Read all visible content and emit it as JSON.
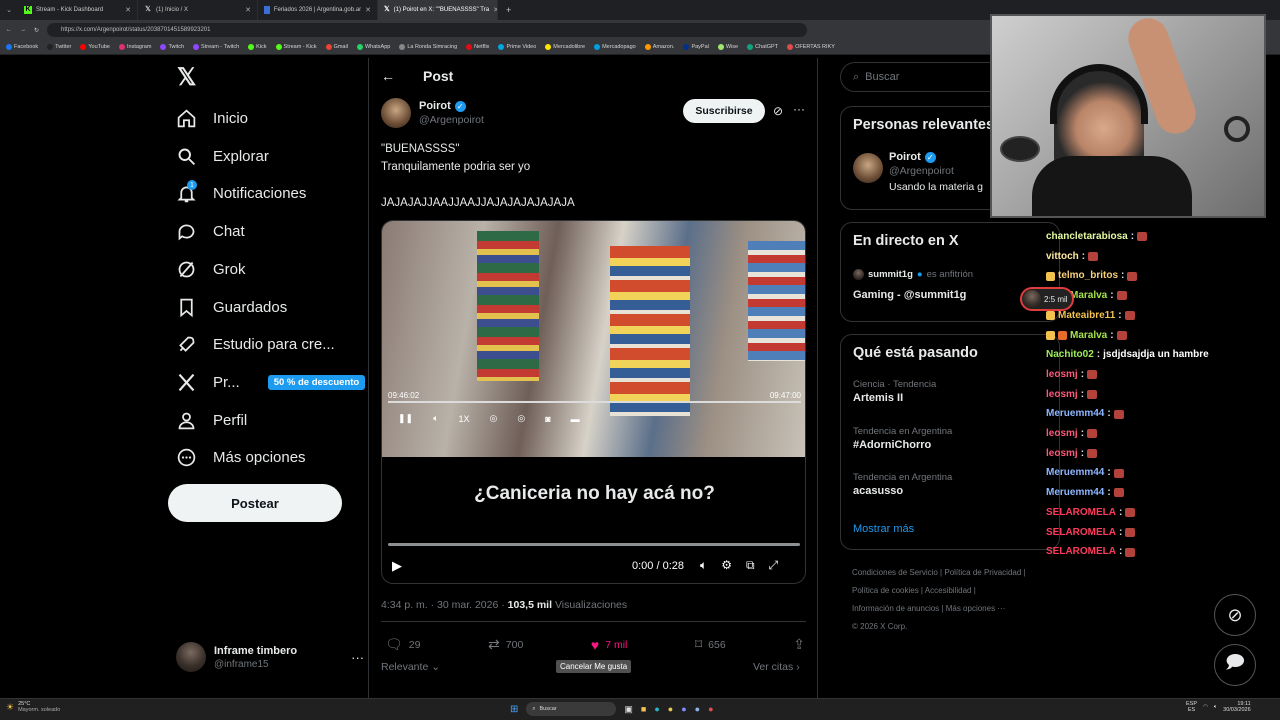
{
  "browser": {
    "tabs": [
      {
        "label": "Stream - Kick Dashboard",
        "icon": "kick-icon",
        "active": false
      },
      {
        "label": "(1) Inicio / X",
        "icon": "x-logo-icon",
        "active": false
      },
      {
        "label": "Feriados 2026 | Argentina.gob.ar",
        "icon": "gob-icon",
        "active": false
      },
      {
        "label": "(1) Poirot en X: \"\"BUENASSSS\" Tra",
        "icon": "x-logo-icon",
        "active": true
      }
    ],
    "new_tab": "+",
    "url": "https://x.com/Argenpoirot/status/2038701451589923201",
    "bookmarks": [
      "Facebook",
      "Twitter",
      "YouTube",
      "Instagram",
      "Twitch",
      "Stream - Twitch",
      "Kick",
      "Stream - Kick",
      "Gmail",
      "WhatsApp",
      "La Ronda Simracing",
      "Netflix",
      "Prime Video",
      "Mercadolibre",
      "Mercadopago",
      "Amazon.",
      "PayPal",
      "Wise",
      "ChatGPT",
      "OFERTAS RIKY"
    ]
  },
  "nav": {
    "items": [
      {
        "label": "Inicio",
        "icon": "home-icon"
      },
      {
        "label": "Explorar",
        "icon": "search-icon"
      },
      {
        "label": "Notificaciones",
        "icon": "bell-icon",
        "badge": "1"
      },
      {
        "label": "Chat",
        "icon": "chat-icon"
      },
      {
        "label": "Grok",
        "icon": "grok-icon"
      },
      {
        "label": "Guardados",
        "icon": "bookmark-icon"
      },
      {
        "label": "Estudio para cre...",
        "icon": "rocket-icon"
      },
      {
        "label": "Pr...",
        "icon": "x-logo-icon",
        "promo": "50 % de descuento"
      },
      {
        "label": "Perfil",
        "icon": "person-icon"
      },
      {
        "label": "Más opciones",
        "icon": "more-circle-icon"
      }
    ],
    "post_button": "Postear",
    "account": {
      "name": "Inframe timbero",
      "handle": "@inframe15"
    }
  },
  "post": {
    "header_title": "Post",
    "author": {
      "name": "Poirot",
      "handle": "@Argenpoirot"
    },
    "subscribe": "Suscribirse",
    "text_lines": [
      "\"BUENASSSS\"",
      "Tranquilamente podria ser yo",
      "JAJAJAJJAAJJAAJJAJAJAJAJAJAJA"
    ],
    "video": {
      "caption": "¿Caniceria no hay acá no?",
      "time": "0:00 / 0:28",
      "cctv_start": "09:46:02",
      "cctv_end": "09:47:00",
      "speed": "1X",
      "progress": 0
    },
    "meta": {
      "time": "4:34 p. m. · 30 mar. 2026 · ",
      "views": "103,5 mil",
      "views_label": " Visualizaciones"
    },
    "actions": {
      "replies": "29",
      "reposts": "700",
      "likes": "7 mil",
      "bookmarks": "656"
    },
    "tooltip": "Cancelar Me gusta",
    "sort_label": "Relevante",
    "quotes_link": "Ver citas"
  },
  "right": {
    "search_placeholder": "Buscar",
    "people": {
      "title": "Personas relevantes",
      "name": "Poirot",
      "handle": "@Argenpoirot",
      "bio": "Usando la materia g"
    },
    "live": {
      "title": "En directo en X",
      "host": "summit1g",
      "host_suffix": "es anfitrión",
      "show": "Gaming - @summit1g"
    },
    "trends": {
      "title": "Qué está pasando",
      "items": [
        {
          "context": "Ciencia · Tendencia",
          "name": "Artemis II"
        },
        {
          "context": "Tendencia en Argentina",
          "name": "#AdorniChorro"
        },
        {
          "context": "Tendencia en Argentina",
          "name": "acasusso"
        }
      ],
      "show_more": "Mostrar más"
    },
    "footer": [
      "Condiciones de Servicio",
      "Política de Privacidad",
      "Política de cookies",
      "Accesibilidad",
      "Información de anuncios",
      "Más opciones ···",
      "© 2026 X Corp."
    ]
  },
  "chat_messages": [
    {
      "user": "chancletarabiosa",
      "text": "",
      "color": "#e4f9a0",
      "badges": 0
    },
    {
      "user": "vittoch",
      "text": "",
      "color": "#ffe8a0",
      "badges": 0
    },
    {
      "user": "telmo_britos",
      "text": "",
      "color": "#f8d078",
      "badges": 1
    },
    {
      "user": "Maralva",
      "text": "",
      "color": "#a6e34f",
      "badges": 2
    },
    {
      "user": "Mateaibre11",
      "text": "",
      "color": "#f2c14e",
      "badges": 1
    },
    {
      "user": "Maralva",
      "text": "",
      "color": "#a6e34f",
      "badges": 2
    },
    {
      "user": "Nachito02",
      "text": "jsdjdsajdja un hambre",
      "color": "#9ef05a",
      "badges": 0
    },
    {
      "user": "leosmj",
      "text": "",
      "color": "#ff5a7a",
      "badges": 0
    },
    {
      "user": "leosmj",
      "text": "",
      "color": "#ff5a7a",
      "badges": 0
    },
    {
      "user": "Meruemm44",
      "text": "",
      "color": "#8db6ff",
      "badges": 0
    },
    {
      "user": "leosmj",
      "text": "",
      "color": "#ff5a7a",
      "badges": 0
    },
    {
      "user": "leosmj",
      "text": "",
      "color": "#ff5a7a",
      "badges": 0
    },
    {
      "user": "Meruemm44",
      "text": "",
      "color": "#8db6ff",
      "badges": 0
    },
    {
      "user": "Meruemm44",
      "text": "",
      "color": "#8db6ff",
      "badges": 0
    },
    {
      "user": "SELAROMELA",
      "text": "",
      "color": "#ff3b5c",
      "badges": 0
    },
    {
      "user": "SELAROMELA",
      "text": "",
      "color": "#ff3b5c",
      "badges": 0
    },
    {
      "user": "SELAROMELA",
      "text": "",
      "color": "#ff3b5c",
      "badges": 0
    }
  ],
  "overlay_timer": "2:5 mil",
  "taskbar": {
    "weather_temp": "25°C",
    "weather_desc": "Mayorm. soleado",
    "search": "Buscar",
    "lang": "ESP",
    "lang_sub": "ES",
    "time": "19:11",
    "date": "30/03/2026"
  },
  "colors": {
    "accent": "#1d9bf0",
    "like": "#f91880",
    "kick": "#53fc18"
  }
}
